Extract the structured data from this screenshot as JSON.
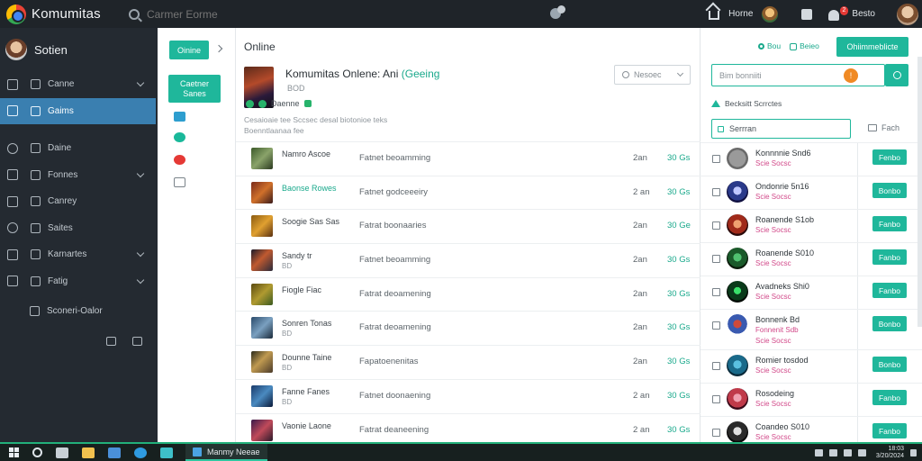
{
  "topbar": {
    "brand": "Komumitas",
    "search_placeholder": "Carmer Eorme",
    "home_label": "Horne",
    "settings_label": "Besto",
    "notification_count": "2"
  },
  "sidebar": {
    "user_name": "Sotien",
    "items": [
      {
        "label": "Canne",
        "chevron": true,
        "active": false
      },
      {
        "label": "Gaims",
        "chevron": false,
        "active": true
      },
      {
        "label": "Daine",
        "chevron": false,
        "active": false
      },
      {
        "label": "Fonnes",
        "chevron": true,
        "active": false
      },
      {
        "label": "Canrey",
        "chevron": false,
        "active": false
      },
      {
        "label": "Saites",
        "chevron": false,
        "active": false
      },
      {
        "label": "Karnartes",
        "chevron": true,
        "active": false
      },
      {
        "label": "Fatig",
        "chevron": true,
        "active": false
      }
    ],
    "sub_item": "Sconeri-Oalor"
  },
  "sidecol": {
    "online_button": "Oinine",
    "card_line1": "Caetner",
    "card_line2": "Sanes"
  },
  "main": {
    "title": "Online",
    "game": {
      "title": "Komumitas Onlene: Ani",
      "title_accent": "(Geeing",
      "meta": "BOD",
      "tag": "Daenne",
      "description": "Cesaioaie tee Sccsec desal biotonioe teks Boenntlaanaa fee"
    },
    "sort_placeholder": "Nesoec",
    "rows": [
      {
        "name": "Namro Ascoe",
        "name2": "",
        "name_green": false,
        "desc": "Fatnet beoamming",
        "n1": "2an",
        "n2": "30 Gs",
        "thumb": "linear-gradient(135deg,#3c5a2a,#8aa36a 50%,#2b3a20)"
      },
      {
        "name": "Baonse Rowes",
        "name2": "",
        "name_green": true,
        "desc": "Fatnet godceeeiry",
        "n1": "2 an",
        "n2": "30 Gs",
        "thumb": "linear-gradient(135deg,#7a2a1a,#d0702a 50%,#3a1a1a)"
      },
      {
        "name": "Soogie Sas Sas",
        "name2": "",
        "name_green": false,
        "desc": "Fatrat boonaaries",
        "n1": "2an",
        "n2": "30 Ge",
        "thumb": "linear-gradient(135deg,#8a5a10,#e0a030 50%,#5a3010)"
      },
      {
        "name": "Sandy tr",
        "name2": "BD",
        "name_green": false,
        "desc": "Fatnet beoamming",
        "n1": "2an",
        "n2": "30 Gs",
        "thumb": "linear-gradient(135deg,#1a1a2a,#c05a30 45%,#2a2a3a)"
      },
      {
        "name": "Fiogle Fiac",
        "name2": "",
        "name_green": false,
        "desc": "Fatrat deoamening",
        "n1": "2an",
        "n2": "30 Gs",
        "thumb": "linear-gradient(135deg,#5a4a10,#b09a30 50%,#3a5a20)"
      },
      {
        "name": "Sonren Tonas",
        "name2": "BD",
        "name_green": false,
        "desc": "Fatrat deoamening",
        "n1": "2an",
        "n2": "30 Gs",
        "thumb": "linear-gradient(135deg,#2a4a6a,#7aa0c0 50%,#1a2a3a)"
      },
      {
        "name": "Dounne Taine",
        "name2": "BD",
        "name_green": false,
        "desc": "Fapatoenenitas",
        "n1": "2an",
        "n2": "30 Gs",
        "thumb": "linear-gradient(135deg,#2a2a1a,#c09a50 45%,#4a3a2a)"
      },
      {
        "name": "Fanne Fanes",
        "name2": "BD",
        "name_green": false,
        "desc": "Fatnet doonaening",
        "n1": "2 an",
        "n2": "30 Gs",
        "thumb": "linear-gradient(135deg,#1a3a6a,#4a8ac0 50%,#0a1a3a)"
      },
      {
        "name": "Vaonie Laone",
        "name2": "",
        "name_green": false,
        "desc": "Fatrat deaneening",
        "n1": "2 an",
        "n2": "30 Gs",
        "thumb": "linear-gradient(135deg,#3a1a4a,#c04a5a 50%,#2a1a2a)"
      }
    ]
  },
  "right": {
    "link1": "Bou",
    "link2": "Beieo",
    "cta": "Ohiimmeblicte",
    "search_placeholder": "Bim bonniiti",
    "section_label": "Becksitt Scrrctes",
    "filter1": "Serrran",
    "filter2": "Fach",
    "users": [
      {
        "name": "Konnnnie Snd6",
        "sub": "Scie Socsc",
        "sub2": "",
        "button": "Fenbo",
        "avatar": "radial-gradient(circle,#9a9a9a 0 55%,#6a6a6a 56%)",
        "tall": false
      },
      {
        "name": "Ondonrie 5n16",
        "sub": "Scie Socsc",
        "sub2": "",
        "button": "Bonbo",
        "avatar": "radial-gradient(circle at 50% 45%,#c0c8ff 0 25%,#2a3a8a 26% 60%,#101040 61%)",
        "tall": false
      },
      {
        "name": "Roanende S1ob",
        "sub": "Scie Socsc",
        "sub2": "",
        "button": "Fanbo",
        "avatar": "radial-gradient(circle at 50% 45%,#f0a070 0 25%,#a02a1a 26% 60%,#2a0a0a 61%)",
        "tall": false
      },
      {
        "name": "Roanende S010",
        "sub": "Scie Socsc",
        "sub2": "",
        "button": "Fanbo",
        "avatar": "radial-gradient(circle at 50% 45%,#50c070 0 25%,#1a5a2a 26% 60%,#0a1a0a 61%)",
        "tall": false
      },
      {
        "name": "Avadneks Shi0",
        "sub": "Scie Socsc",
        "sub2": "",
        "button": "Fanbo",
        "avatar": "radial-gradient(circle at 50% 45%,#3ae06a 0 22%,#0a3a1a 23% 60%,#020a04 61%)",
        "tall": false
      },
      {
        "name": "Bonnenk Bd",
        "sub": "Fonnenit Sdb",
        "sub2": "Scie Socsc",
        "button": "Bonbo",
        "avatar": "radial-gradient(circle at 50% 45%,#d04a3a 0 25%,#3a5ab0 26% 60%,#ffffff 61%)",
        "tall": true
      },
      {
        "name": "Romier tosdod",
        "sub": "Scie Socsc",
        "sub2": "",
        "button": "Bonbo",
        "avatar": "radial-gradient(circle at 50% 45%,#5ac0e0 0 25%,#1a6a8a 26% 60%,#0a2a3a 61%)",
        "tall": false
      },
      {
        "name": "Rosodeing",
        "sub": "Scie Socsc",
        "sub2": "",
        "button": "Fanbo",
        "avatar": "radial-gradient(circle at 50% 45%,#f0a0b0 0 25%,#c03a4a 26% 60%,#3a0a1a 61%)",
        "tall": false
      },
      {
        "name": "Coandeo S010",
        "sub": "Scie Socsc",
        "sub2": "",
        "button": "Fanbo",
        "avatar": "radial-gradient(circle at 50% 45%,#e0e0e0 0 25%,#2a2a2a 26% 60%,#0a0a0a 61%)",
        "tall": false
      }
    ]
  },
  "taskbar": {
    "app_label": "Manmy Neeae",
    "clock_line1": "18:03",
    "clock_line2": "3/20/2024"
  },
  "colors": {
    "accent": "#1fb79b",
    "sidebar_active": "#3a7fb0",
    "sidebar_bg": "#242a31"
  }
}
